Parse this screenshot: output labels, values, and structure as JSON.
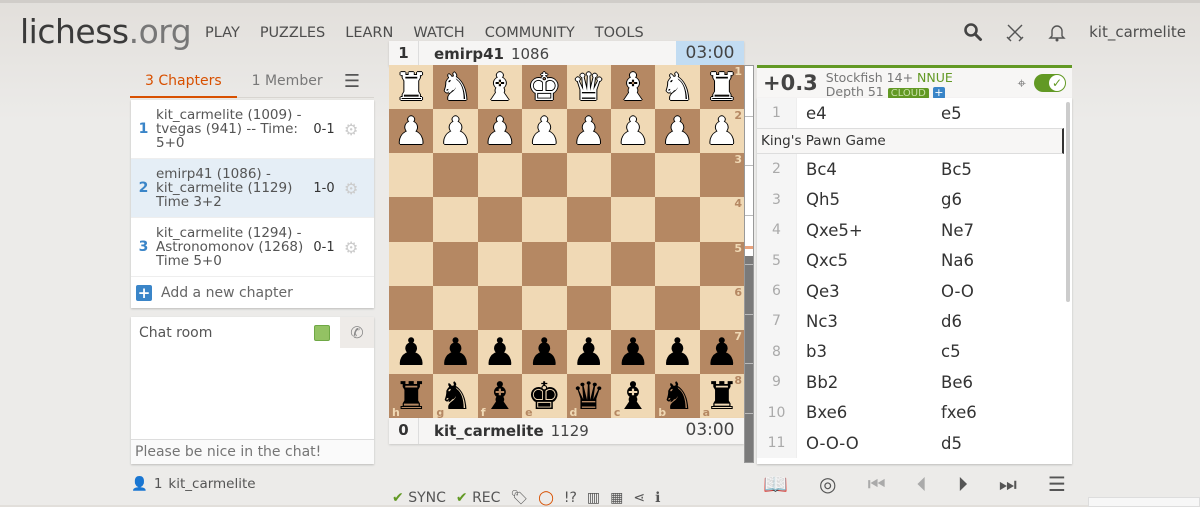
{
  "header": {
    "logo_main": "lichess",
    "logo_tld": ".org",
    "nav": [
      "PLAY",
      "PUZZLES",
      "LEARN",
      "WATCH",
      "COMMUNITY",
      "TOOLS"
    ],
    "username": "kit_carmelite"
  },
  "study": {
    "tabs": {
      "chapters": "3 Chapters",
      "members": "1 Member"
    },
    "chapters": [
      {
        "num": "1",
        "name": "kit_carmelite (1009) - tvegas (941) -- Time: 5+0",
        "result": "0-1",
        "active": false
      },
      {
        "num": "2",
        "name": "emirp41 (1086) - kit_carmelite (1129) Time 3+2",
        "result": "1-0",
        "active": true
      },
      {
        "num": "3",
        "name": "kit_carmelite (1294) - Astronomonov (1268) Time 5+0",
        "result": "0-1",
        "active": false
      }
    ],
    "add_chapter": "Add a new chapter"
  },
  "chat": {
    "title": "Chat room",
    "placeholder": "Please be nice in the chat!"
  },
  "members_bar": {
    "count": "1",
    "name": "kit_carmelite"
  },
  "top_player": {
    "score": "1",
    "name": "emirp41",
    "rating": "1086",
    "clock": "03:00"
  },
  "bottom_player": {
    "score": "0",
    "name": "kit_carmelite",
    "rating": "1129",
    "clock": "03:00"
  },
  "board": {
    "orientation": "black",
    "files_displayed": [
      "h",
      "g",
      "f",
      "e",
      "d",
      "c",
      "b",
      "a"
    ],
    "ranks_displayed": [
      "1",
      "2",
      "3",
      "4",
      "5",
      "6",
      "7",
      "8"
    ],
    "rows": [
      [
        "wR",
        "wN",
        "wB",
        "wK",
        "wQ",
        "wB",
        "wN",
        "wR"
      ],
      [
        "wP",
        "wP",
        "wP",
        "wP",
        "wP",
        "wP",
        "wP",
        "wP"
      ],
      [
        "",
        "",
        "",
        "",
        "",
        "",
        "",
        ""
      ],
      [
        "",
        "",
        "",
        "",
        "",
        "",
        "",
        ""
      ],
      [
        "",
        "",
        "",
        "",
        "",
        "",
        "",
        ""
      ],
      [
        "",
        "",
        "",
        "",
        "",
        "",
        "",
        ""
      ],
      [
        "bP",
        "bP",
        "bP",
        "bP",
        "bP",
        "bP",
        "bP",
        "bP"
      ],
      [
        "bR",
        "bN",
        "bB",
        "bK",
        "bQ",
        "bB",
        "bN",
        "bR"
      ]
    ]
  },
  "eval_gauge": {
    "white_fraction": 0.48
  },
  "board_tools": {
    "sync": "SYNC",
    "rec": "REC"
  },
  "ceval": {
    "score": "+0.3",
    "engine": "Stockfish 14+",
    "nnue": "NNUE",
    "depth": "Depth 51",
    "cloud": "CLOUD",
    "enabled": true
  },
  "moves": [
    {
      "n": "1",
      "w": "e4",
      "b": "e5"
    },
    {
      "opening": "King's Pawn Game"
    },
    {
      "n": "2",
      "w": "Bc4",
      "b": "Bc5"
    },
    {
      "n": "3",
      "w": "Qh5",
      "b": "g6"
    },
    {
      "n": "4",
      "w": "Qxe5+",
      "b": "Ne7"
    },
    {
      "n": "5",
      "w": "Qxc5",
      "b": "Na6"
    },
    {
      "n": "6",
      "w": "Qe3",
      "b": "O-O"
    },
    {
      "n": "7",
      "w": "Nc3",
      "b": "d6"
    },
    {
      "n": "8",
      "w": "b3",
      "b": "c5"
    },
    {
      "n": "9",
      "w": "Bb2",
      "b": "Be6"
    },
    {
      "n": "10",
      "w": "Bxe6",
      "b": "fxe6"
    },
    {
      "n": "11",
      "w": "O-O-O",
      "b": "d5"
    }
  ],
  "icons": {
    "wK": "♚",
    "wQ": "♛",
    "wR": "♜",
    "wB": "♝",
    "wN": "♞",
    "wP": "♟",
    "bK": "♚",
    "bQ": "♛",
    "bR": "♜",
    "bB": "♝",
    "bN": "♞",
    "bP": "♟"
  }
}
